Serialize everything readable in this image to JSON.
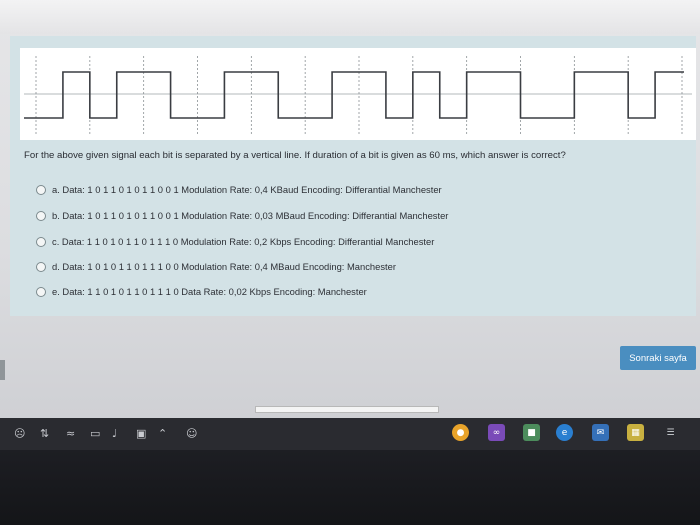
{
  "question": {
    "text": "For the above given signal each bit is separated by a vertical line. If duration of a bit is given as 60 ms, which answer is correct?"
  },
  "options": [
    {
      "text": "a. Data: 1 0 1 1 0 1 0 1 1 0 0 1 Modulation Rate: 0,4 KBaud Encoding: Differantial Manchester"
    },
    {
      "text": "b. Data: 1 0 1 1 0 1 0 1 1 0 0 1 Modulation Rate: 0,03 MBaud Encoding: Differantial Manchester"
    },
    {
      "text": "c. Data: 1 1 0 1 0 1 1 0 1 1 1 0 Modulation Rate: 0,2 Kbps Encoding: Differantial Manchester"
    },
    {
      "text": "d. Data: 1 0 1 0 1 1 0 1 1 1 0 0 Modulation Rate: 0,4 MBaud Encoding: Manchester"
    },
    {
      "text": "e. Data: 1 1 0 1 0 1 1 0 1 1 1 0 Data Rate: 0,02 Kbps Encoding: Manchester"
    }
  ],
  "buttons": {
    "next": "Sonraki sayfa"
  },
  "signal": {
    "bit_count": 12,
    "levels": [
      0,
      1,
      0,
      1,
      1,
      0,
      0,
      1,
      1,
      0,
      0,
      1,
      1,
      0,
      1,
      0,
      1,
      1,
      0,
      0,
      1,
      1,
      0,
      1
    ]
  },
  "taskbar": {
    "tray_icons": [
      "people-icon",
      "bluetooth-icon",
      "wifi-icon",
      "battery-icon",
      "volume-icon",
      "device-icon",
      "chevron-up-icon"
    ],
    "apps": [
      "chrome-icon",
      "visual-studio-icon",
      "app-icon",
      "edge-icon",
      "mail-icon",
      "store-icon",
      "notification-icon"
    ]
  }
}
